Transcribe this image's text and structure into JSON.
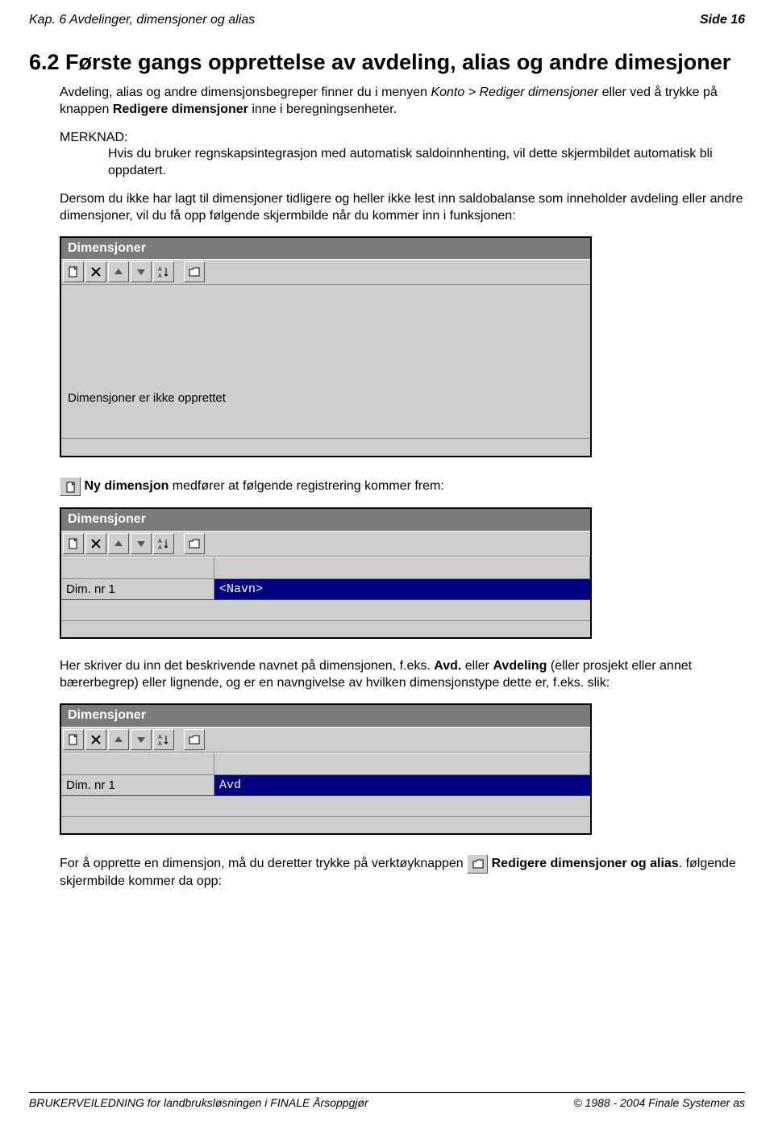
{
  "header": {
    "left": "Kap. 6 Avdelinger, dimensjoner og alias",
    "right": "Side 16"
  },
  "section": {
    "title": "6.2  Første gangs opprettelse av avdeling, alias og andre dimesjoner",
    "p1_a": "Avdeling, alias og andre dimensjonsbegreper finner du i menyen ",
    "p1_b": "Konto > Rediger dimensjoner",
    "p1_c": " eller ved å trykke på knappen ",
    "p1_d": "Redigere dimensjoner",
    "p1_e": " inne i beregningsenheter.",
    "merk_label": "MERKNAD:",
    "merk_body": "Hvis du bruker regnskapsintegrasjon med automatisk saldoinnhenting, vil dette skjermbildet automatisk bli oppdatert.",
    "p2": "Dersom du ikke har lagt til dimensjoner tidligere og heller ikke lest inn saldobalanse som inneholder avdeling eller andre dimensjoner, vil du få opp følgende skjermbilde når du kommer inn i funksjonen:"
  },
  "panel1": {
    "title": "Dimensjoner",
    "msg": "Dimensjoner er ikke opprettet"
  },
  "line_newdim_a": "Ny dimensjon",
  "line_newdim_b": " medfører at følgende registrering kommer frem:",
  "panel2": {
    "title": "Dimensjoner",
    "row_label": "Dim. nr 1",
    "row_value": "<Navn>"
  },
  "p3_a": "Her skriver du inn det beskrivende navnet på dimensjonen, f.eks. ",
  "p3_b": "Avd.",
  "p3_c": " eller ",
  "p3_d": "Avdeling",
  "p3_e": " (eller prosjekt eller annet bærerbegrep) eller lignende, og er en navngivelse av hvilken dimensjonstype dette er, f.eks. slik:",
  "panel3": {
    "title": "Dimensjoner",
    "row_label": "Dim. nr 1",
    "row_value": "Avd"
  },
  "p4_a": "For å opprette en dimensjon, må du deretter trykke på verktøyknappen ",
  "p4_b": "Redigere dimensjoner og alias",
  "p4_c": ". følgende skjermbilde kommer da opp:",
  "footer": {
    "left": "BRUKERVEILEDNING for landbruksløsningen i FINALE Årsoppgjør",
    "right": "© 1988 - 2004 Finale Systemer as"
  }
}
